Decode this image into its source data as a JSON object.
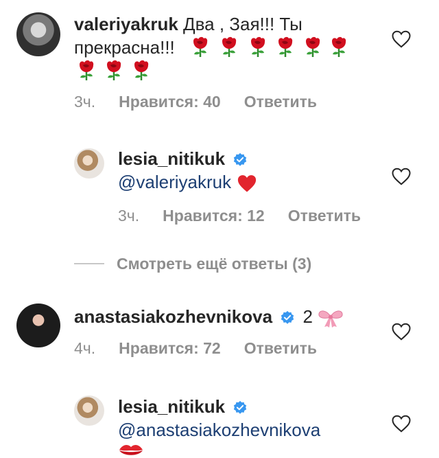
{
  "comments": [
    {
      "username": "valeriyakruk",
      "text_line1": "Два , Зая!!! Ты",
      "text_line2": "прекрасна!!!",
      "time": "3ч.",
      "likes": "Нравится: 40",
      "reply": "Ответить"
    },
    {
      "username": "lesia_nitikuk",
      "mention": "@valeriyakruk",
      "time": "3ч.",
      "likes": "Нравится: 12",
      "reply": "Ответить"
    },
    {
      "username": "anastasiakozhevnikova",
      "text": "2",
      "time": "4ч.",
      "likes": "Нравится: 72",
      "reply": "Ответить"
    },
    {
      "username": "lesia_nitikuk",
      "mention": "@anastasiakozhevnikova"
    }
  ],
  "view_more": "Смотреть ещё ответы (3)",
  "colors": {
    "mention": "#1d3f73",
    "verified": "#3897f0",
    "meta": "#8e8e8e"
  }
}
